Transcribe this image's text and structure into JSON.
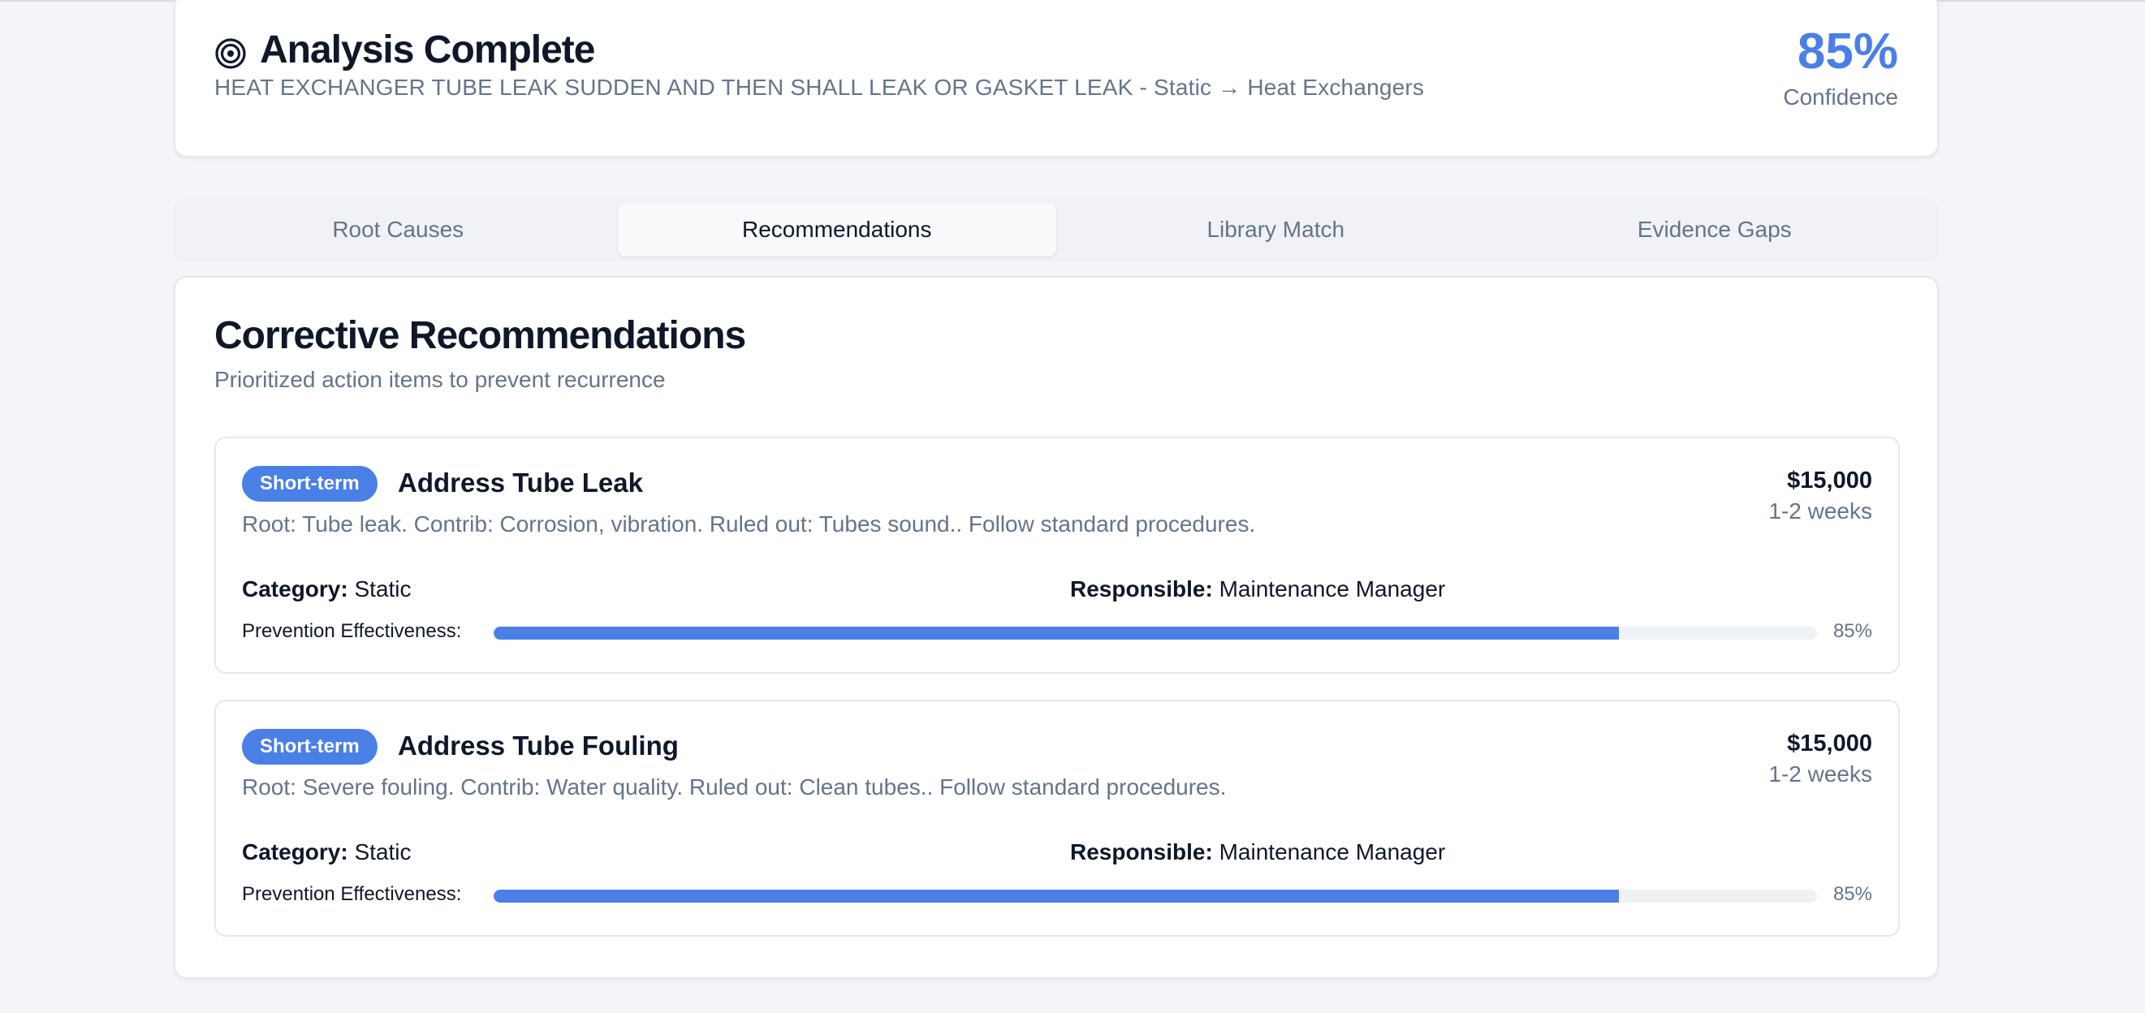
{
  "header": {
    "icon": "target-icon",
    "title": "Analysis Complete",
    "subtitle": "HEAT EXCHANGER TUBE LEAK SUDDEN AND THEN SHALL LEAK OR GASKET LEAK - Static → Heat Exchangers",
    "confidence_value": "85%",
    "confidence_label": "Confidence"
  },
  "tabs": [
    {
      "label": "Root Causes",
      "active": false
    },
    {
      "label": "Recommendations",
      "active": true
    },
    {
      "label": "Library Match",
      "active": false
    },
    {
      "label": "Evidence Gaps",
      "active": false
    }
  ],
  "section": {
    "title": "Corrective Recommendations",
    "subtitle": "Prioritized action items to prevent recurrence"
  },
  "recommendations": [
    {
      "badge": "Short-term",
      "title": "Address Tube Leak",
      "description": "Root: Tube leak. Contrib: Corrosion, vibration. Ruled out: Tubes sound.. Follow standard procedures.",
      "cost": "$15,000",
      "timeline": "1-2 weeks",
      "category_label": "Category:",
      "category": "Static",
      "responsible_label": "Responsible:",
      "responsible": "Maintenance Manager",
      "effectiveness_label": "Prevention Effectiveness:",
      "effectiveness_pct": "85%",
      "effectiveness": 0.85
    },
    {
      "badge": "Short-term",
      "title": "Address Tube Fouling",
      "description": "Root: Severe fouling. Contrib: Water quality. Ruled out: Clean tubes.. Follow standard procedures.",
      "cost": "$15,000",
      "timeline": "1-2 weeks",
      "category_label": "Category:",
      "category": "Static",
      "responsible_label": "Responsible:",
      "responsible": "Maintenance Manager",
      "effectiveness_label": "Prevention Effectiveness:",
      "effectiveness_pct": "85%",
      "effectiveness": 0.85
    }
  ],
  "colors": {
    "accent": "#4a7fe6",
    "muted_text": "#64748b",
    "text": "#0f172a"
  }
}
